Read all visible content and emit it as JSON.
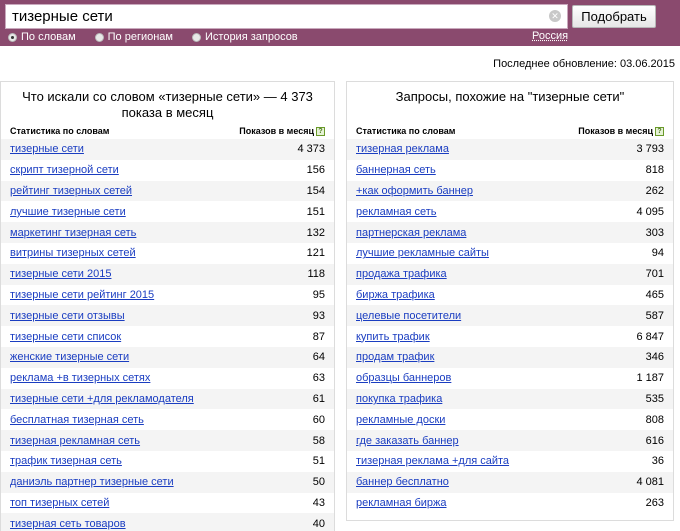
{
  "search": {
    "query": "тизерные сети",
    "submit_label": "Подобрать"
  },
  "modes": [
    {
      "label": "По словам",
      "checked": true
    },
    {
      "label": "По регионам",
      "checked": false
    },
    {
      "label": "История запросов",
      "checked": false
    }
  ],
  "region": "Россия",
  "last_update": "Последнее обновление: 03.06.2015",
  "left": {
    "title": "Что искали со словом «тизерные сети» — 4 373 показа в месяц",
    "col_keyword": "Статистика по словам",
    "col_count": "Показов в месяц",
    "rows": [
      {
        "kw": "тизерные сети",
        "cnt": "4 373"
      },
      {
        "kw": "скрипт тизерной сети",
        "cnt": "156"
      },
      {
        "kw": "рейтинг тизерных сетей",
        "cnt": "154"
      },
      {
        "kw": "лучшие тизерные сети",
        "cnt": "151"
      },
      {
        "kw": "маркетинг тизерная сеть",
        "cnt": "132"
      },
      {
        "kw": "витрины тизерных сетей",
        "cnt": "121"
      },
      {
        "kw": "тизерные сети 2015",
        "cnt": "118"
      },
      {
        "kw": "тизерные сети рейтинг 2015",
        "cnt": "95"
      },
      {
        "kw": "тизерные сети отзывы",
        "cnt": "93"
      },
      {
        "kw": "тизерные сети список",
        "cnt": "87"
      },
      {
        "kw": "женские тизерные сети",
        "cnt": "64"
      },
      {
        "kw": "реклама +в тизерных сетях",
        "cnt": "63"
      },
      {
        "kw": "тизерные сети +для рекламодателя",
        "cnt": "61"
      },
      {
        "kw": "бесплатная тизерная сеть",
        "cnt": "60"
      },
      {
        "kw": "тизерная рекламная сеть",
        "cnt": "58"
      },
      {
        "kw": "трафик тизерная сеть",
        "cnt": "51"
      },
      {
        "kw": "даниэль партнер тизерные сети",
        "cnt": "50"
      },
      {
        "kw": "топ тизерных сетей",
        "cnt": "43"
      },
      {
        "kw": "тизерная сеть товаров",
        "cnt": "40"
      }
    ]
  },
  "right": {
    "title": "Запросы, похожие на \"тизерные сети\"",
    "col_keyword": "Статистика по словам",
    "col_count": "Показов в месяц",
    "rows": [
      {
        "kw": "тизерная реклама",
        "cnt": "3 793"
      },
      {
        "kw": "баннерная сеть",
        "cnt": "818"
      },
      {
        "kw": "+как оформить баннер",
        "cnt": "262"
      },
      {
        "kw": "рекламная сеть",
        "cnt": "4 095"
      },
      {
        "kw": "партнерская реклама",
        "cnt": "303"
      },
      {
        "kw": "лучшие рекламные сайты",
        "cnt": "94"
      },
      {
        "kw": "продажа трафика",
        "cnt": "701"
      },
      {
        "kw": "биржа трафика",
        "cnt": "465"
      },
      {
        "kw": "целевые посетители",
        "cnt": "587"
      },
      {
        "kw": "купить трафик",
        "cnt": "6 847"
      },
      {
        "kw": "продам трафик",
        "cnt": "346"
      },
      {
        "kw": "образцы баннеров",
        "cnt": "1 187"
      },
      {
        "kw": "покупка трафика",
        "cnt": "535"
      },
      {
        "kw": "рекламные доски",
        "cnt": "808"
      },
      {
        "kw": "где заказать баннер",
        "cnt": "616"
      },
      {
        "kw": "тизерная реклама +для сайта",
        "cnt": "36"
      },
      {
        "kw": "баннер бесплатно",
        "cnt": "4 081"
      },
      {
        "kw": "рекламная биржа",
        "cnt": "263"
      }
    ]
  },
  "help_glyph": "?"
}
